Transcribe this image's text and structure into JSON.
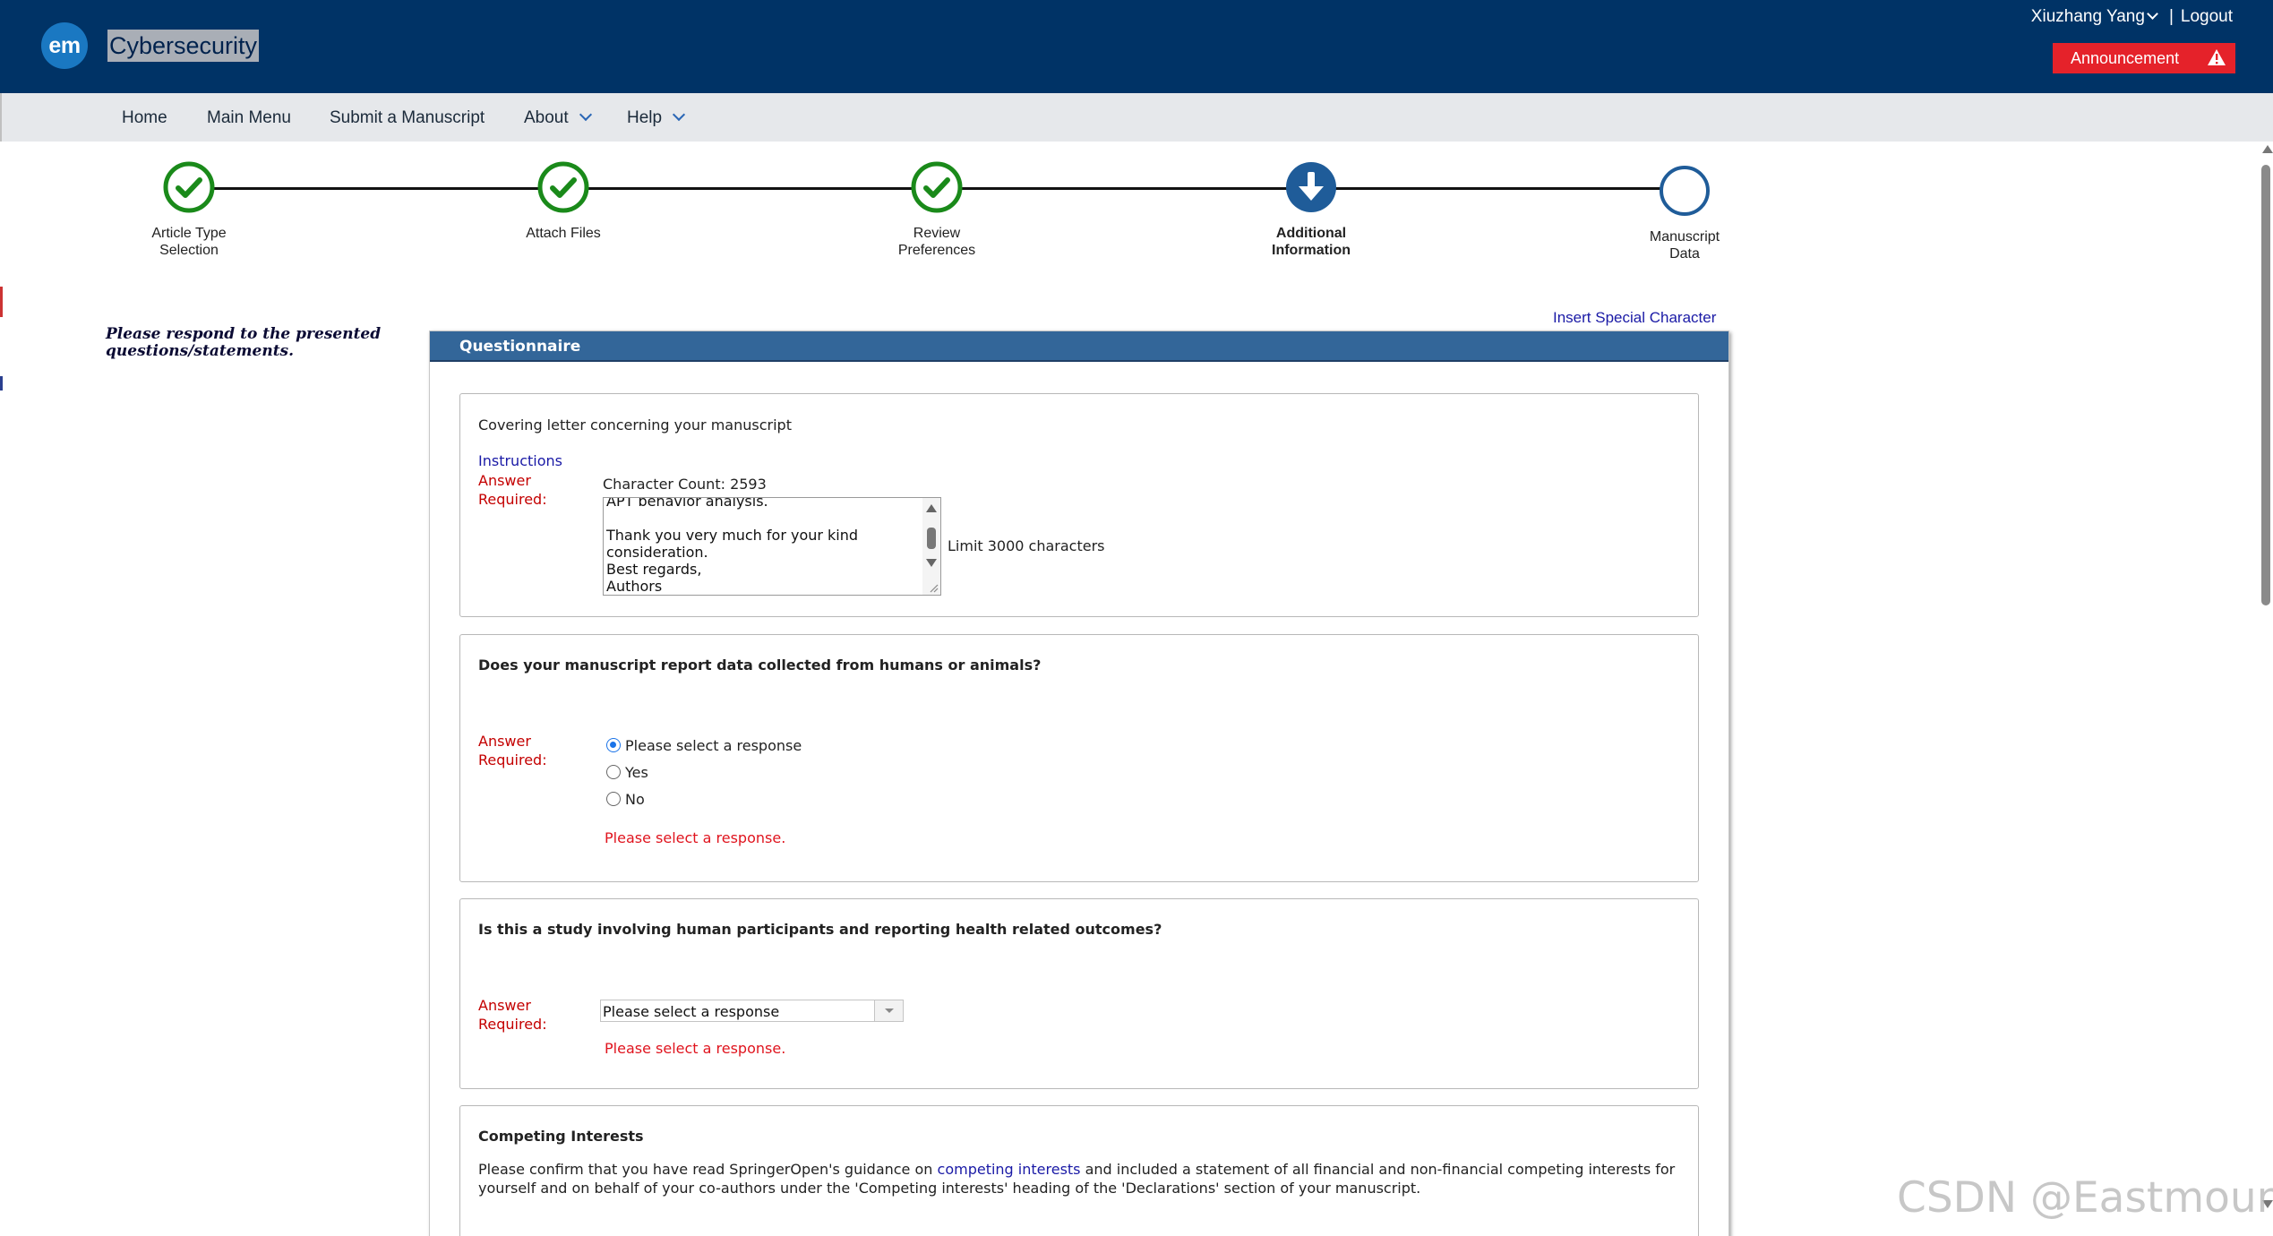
{
  "header": {
    "logo_text": "em",
    "journal_title": "Cybersecurity",
    "user_name": "Xiuzhang Yang",
    "separator": "|",
    "logout_label": "Logout",
    "announcement_label": "Announcement"
  },
  "nav": {
    "items": [
      "Home",
      "Main Menu",
      "Submit a Manuscript",
      "About",
      "Help"
    ]
  },
  "steps": [
    {
      "label_line1": "Article Type",
      "label_line2": "Selection",
      "status": "complete"
    },
    {
      "label_line1": "Attach Files",
      "label_line2": "",
      "status": "complete"
    },
    {
      "label_line1": "Review",
      "label_line2": "Preferences",
      "status": "complete"
    },
    {
      "label_line1": "Additional",
      "label_line2": "Information",
      "status": "current"
    },
    {
      "label_line1": "Manuscript",
      "label_line2": "Data",
      "status": "pending"
    }
  ],
  "instructions_text": "Please respond to the presented questions/statements.",
  "insert_special_character": "Insert Special Character",
  "questionnaire": {
    "header": "Questionnaire",
    "q1": {
      "title": "Covering letter concerning your manuscript",
      "instructions_link": "Instructions",
      "answer_required_1": "Answer",
      "answer_required_2": "Required:",
      "char_count": "Character Count: 2593",
      "textarea_value": "APT behavior analysis.\n\nThank you very much for your kind consideration.\nBest regards,\nAuthors",
      "limit_text": "Limit 3000 characters"
    },
    "q2": {
      "title": "Does your manuscript report data collected from humans or animals?",
      "answer_required_1": "Answer",
      "answer_required_2": "Required:",
      "options": [
        "Please select a response",
        "Yes",
        "No"
      ],
      "selected": "Please select a response",
      "error": "Please select a response."
    },
    "q3": {
      "title": "Is this a study involving human participants and reporting health related outcomes?",
      "answer_required_1": "Answer",
      "answer_required_2": "Required:",
      "select_value": "Please select a response",
      "error": "Please select a response."
    },
    "q4": {
      "title": "Competing Interests",
      "text_before": "Please confirm that you have read SpringerOpen's guidance on",
      "link": "competing interests",
      "text_after": "and included a statement of all financial and non-financial competing interests for",
      "text_line2": "yourself and on behalf of your co-authors under the 'Competing interests' heading of the 'Declarations' section of your manuscript."
    }
  },
  "watermark": "CSDN @Eastmount",
  "colors": {
    "header_bg": "#003366",
    "nav_bg": "#e6e8eb",
    "complete_green": "#1a8a1a",
    "current_blue": "#1f5c99",
    "panel_header": "#336699",
    "required_red": "#c40000",
    "error_red": "#e0141e",
    "announcement_red": "#e5222a"
  }
}
